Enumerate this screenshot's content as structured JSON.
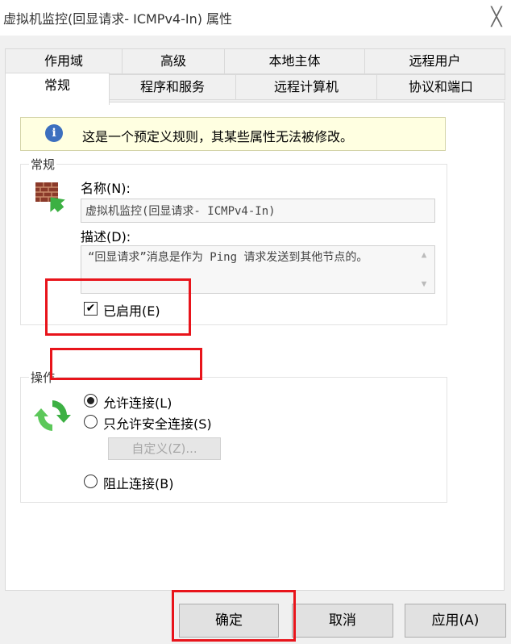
{
  "window": {
    "title": "虚拟机监控(回显请求- ICMPv4-In) 属性",
    "close_glyph": "╳"
  },
  "tabs_row1": [
    {
      "label": "作用域"
    },
    {
      "label": "高级"
    },
    {
      "label": "本地主体"
    },
    {
      "label": "远程用户"
    }
  ],
  "tabs_row2": [
    {
      "label": "常规",
      "active": true
    },
    {
      "label": "程序和服务"
    },
    {
      "label": "远程计算机"
    },
    {
      "label": "协议和端口"
    }
  ],
  "notice": {
    "icon": "info-icon",
    "icon_glyph": "i",
    "text": "这是一个预定义规则，其某些属性无法被修改。"
  },
  "general_group": {
    "label": "常规",
    "icon": "firewall-rule-icon",
    "name_label": "名称(N):",
    "name_value": "虚拟机监控(回显请求- ICMPv4-In)",
    "desc_label": "描述(D):",
    "desc_value": "“回显请求”消息是作为 Ping 请求发送到其他节点的。",
    "enabled_label": "已启用(E)",
    "enabled": true
  },
  "action_group": {
    "label": "操作",
    "icon": "allow-arrows-icon",
    "options": [
      {
        "label": "允许连接(L)",
        "selected": true
      },
      {
        "label": "只允许安全连接(S)",
        "selected": false
      },
      {
        "label": "阻止连接(B)",
        "selected": false
      }
    ],
    "customize_label": "自定义(Z)..."
  },
  "buttons": {
    "ok": "确定",
    "cancel": "取消",
    "apply": "应用(A)"
  },
  "colors": {
    "highlight": "#e8141b",
    "notice_bg": "#ffffe1",
    "dialog_bg": "#f0f0f0"
  }
}
